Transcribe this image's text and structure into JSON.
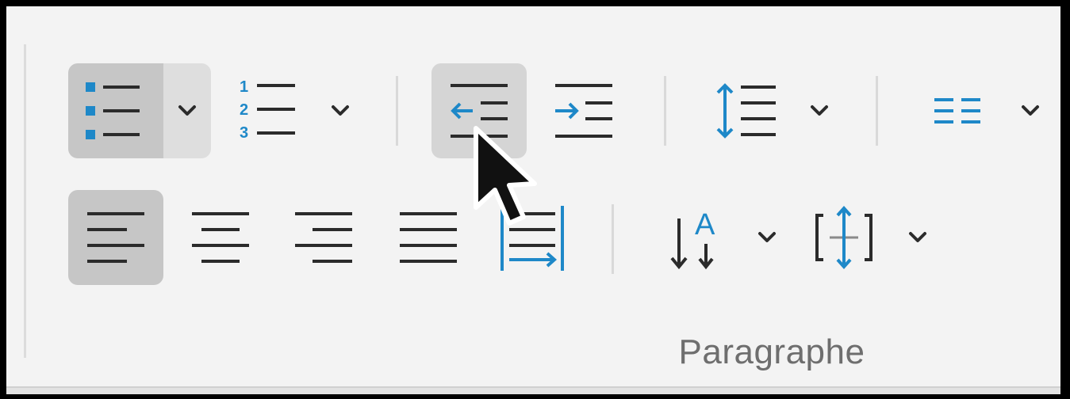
{
  "ribbon": {
    "group_label": "Paragraphe",
    "accent_color": "#1e88c8",
    "icon_color": "#2b2b2b"
  },
  "row1": [
    {
      "name": "bullets-button",
      "icon": "bulleted-list-icon",
      "state": "active",
      "has_dropdown": true
    },
    {
      "name": "numbering-button",
      "icon": "numbered-list-icon",
      "has_dropdown": true
    },
    {
      "name": "decrease-indent-button",
      "icon": "decrease-indent-icon",
      "state": "hover"
    },
    {
      "name": "increase-indent-button",
      "icon": "increase-indent-icon"
    },
    {
      "name": "line-spacing-button",
      "icon": "line-spacing-icon",
      "has_dropdown": true
    },
    {
      "name": "columns-button",
      "icon": "columns-icon",
      "has_dropdown": true
    }
  ],
  "row2": [
    {
      "name": "align-left-button",
      "icon": "align-left-icon",
      "state": "active"
    },
    {
      "name": "align-center-button",
      "icon": "align-center-icon"
    },
    {
      "name": "align-right-button",
      "icon": "align-right-icon"
    },
    {
      "name": "justify-button",
      "icon": "justify-icon"
    },
    {
      "name": "distributed-button",
      "icon": "distributed-icon"
    },
    {
      "name": "text-direction-button",
      "icon": "text-direction-icon",
      "has_dropdown": true
    },
    {
      "name": "vertical-align-button",
      "icon": "vertical-align-icon",
      "has_dropdown": true
    }
  ],
  "numbered_list_digits": [
    "1",
    "2",
    "3"
  ],
  "text_direction_letter": "A"
}
